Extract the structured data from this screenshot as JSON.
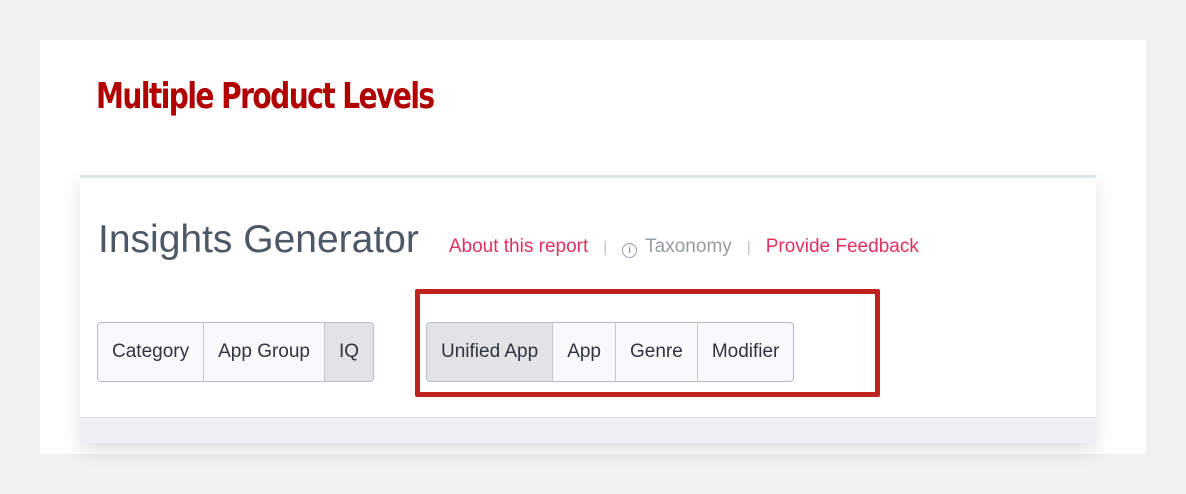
{
  "slide": {
    "title": "Multiple Product Levels"
  },
  "report": {
    "title": "Insights Generator",
    "links": {
      "about": "About this report",
      "taxonomy": "Taxonomy",
      "feedback": "Provide Feedback"
    },
    "separator": "|"
  },
  "levels_left": [
    {
      "label": "Category",
      "active": false
    },
    {
      "label": "App Group",
      "active": false
    },
    {
      "label": "IQ",
      "active": true
    }
  ],
  "levels_right": [
    {
      "label": "Unified App",
      "active": true
    },
    {
      "label": "App",
      "active": false
    },
    {
      "label": "Genre",
      "active": false
    },
    {
      "label": "Modifier",
      "active": false
    }
  ],
  "colors": {
    "title_red": "#b00000",
    "link_pink": "#e0315f",
    "highlight_red": "#c0221f"
  }
}
